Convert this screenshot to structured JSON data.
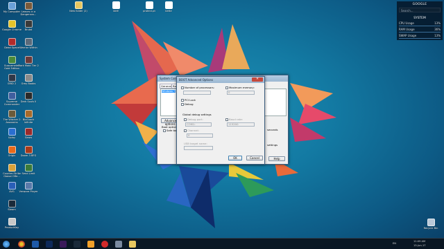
{
  "desktop_icons": [
    {
      "label": "My Computer",
      "color": "#6aa0d8"
    },
    {
      "label": "Google Chrome",
      "color": "#e6c32a"
    },
    {
      "label": "Dead Space",
      "color": "#b22b2b"
    },
    {
      "label": "Guacamelee Gold Edition",
      "color": "#4a8a3a"
    },
    {
      "label": "GRID 2",
      "color": "#303848"
    },
    {
      "label": "Supreme Commander",
      "color": "#3f5f9f"
    },
    {
      "label": "The Witcher 2 Assassins",
      "color": "#6a5a3a"
    },
    {
      "label": "Uplay",
      "color": "#2a6fd0"
    },
    {
      "label": "Origin",
      "color": "#e86a1a"
    },
    {
      "label": "Counter-Strike Global Offe...",
      "color": "#d9a23a"
    },
    {
      "label": "AVG",
      "color": "#2a5fb8"
    },
    {
      "label": "Firefox Nightly",
      "color": "#3a4a9a"
    },
    {
      "label": "Leaves in a Dangerous...",
      "color": "#7a5a3a"
    },
    {
      "label": "Brutal",
      "color": "#3a3a3a"
    },
    {
      "label": "Warrior Within",
      "color": "#5a6a7a"
    },
    {
      "label": "Dark Maid Tier 2",
      "color": "#6a3a3a"
    },
    {
      "label": "Grey Boobs",
      "color": "#8a8a8a"
    },
    {
      "label": "Dark Souls II",
      "color": "#2a2a2a"
    },
    {
      "label": "BioShock Infinite",
      "color": "#a86a2a"
    },
    {
      "label": "Gears",
      "color": "#9a2a2a"
    },
    {
      "label": "Doom 3 BFG",
      "color": "#a83a1a"
    },
    {
      "label": "Send Limit",
      "color": "#3a7a3a"
    },
    {
      "label": "Vmware Player",
      "color": "#5a7aaa"
    },
    {
      "label": "Recycle Bin",
      "color": "#b8c8d8"
    },
    {
      "label": "Steam",
      "color": "#1a2a3a"
    },
    {
      "label": "ProductKey",
      "color": "#c8c8c8"
    }
  ],
  "top_files": [
    {
      "label": "New folder (2)",
      "color": "#e8c860"
    },
    {
      "label": "ideé",
      "color": "#ffffff"
    },
    {
      "label": "protect.pt",
      "color": "#ffffff"
    },
    {
      "label": "bette",
      "color": "#ffffff"
    }
  ],
  "gadget": {
    "google_title": "GOOGLE",
    "search_placeholder": "Search...",
    "system_title": "SYSTEM",
    "rows": [
      {
        "name": "CPU Usage",
        "value": "13%"
      },
      {
        "name": "RAM Usage",
        "value": "36%"
      },
      {
        "name": "SWAP Usage",
        "value": "13%"
      }
    ]
  },
  "sysconfig": {
    "title": "System Configuration",
    "tabs": [
      "General",
      "Boot"
    ],
    "list_item": "Windows 7",
    "advanced_button": "Advanced options...",
    "boot_options_label": "Boot options",
    "safe_boot": "Safe boot",
    "help_button": "Help",
    "seconds_label": "seconds",
    "settings_label": "settings"
  },
  "boot_dialog": {
    "title": "BOOT Advanced Options",
    "number_of_processors": "Number of processors:",
    "maximum_memory": "Maximum memory:",
    "processors_value": "",
    "memory_value": "0",
    "pci_lock": "PCI Lock",
    "debug": "Debug",
    "global_debug_settings": "Global debug settings",
    "debug_port": "Debug port:",
    "baud_rate": "Baud rate:",
    "port_value": "COM1:",
    "baud_value": "115200",
    "channel": "Channel:",
    "channel_value": "0",
    "usb_target_name": "USB target name:",
    "ok_button": "OK",
    "cancel_button": "Cancel"
  },
  "taskbar": {
    "language": "EN",
    "time": "11:09 AM",
    "date": "13-Jun-17",
    "colors": {
      "accent": "#2e7fc0"
    }
  }
}
